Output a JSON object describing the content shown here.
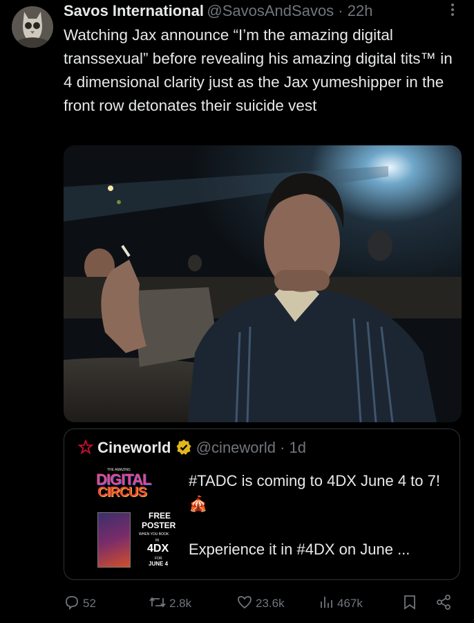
{
  "tweet": {
    "display_name": "Savos International",
    "handle": "@SavosAndSavos",
    "separator": " · ",
    "time": "22h",
    "text": "Watching Jax announce “I’m the amazing digital transsexual” before revealing his amazing digital tits™ in 4 dimensional clarity just as the Jax yumeshipper in the front row detonates their suicide vest"
  },
  "media": {
    "icon": "movie-theater-photo"
  },
  "quote": {
    "display_name": "Cineworld",
    "handle": "@cineworld",
    "separator": " · ",
    "time": "1d",
    "text_line1": "#TADC is coming to 4DX June 4 to 7! 🎪",
    "text_line2": "Experience it in #4DX on June ...",
    "thumb": {
      "tag": "THE AMAZING",
      "title1": "DIGITAL",
      "title2": "CIRCUS",
      "free": "FREE",
      "poster": "POSTER",
      "when": "WHEN YOU BOOK",
      "in": "IN",
      "brand": "4DX",
      "for": "FOR",
      "date": "JUNE 4"
    }
  },
  "actions": {
    "replies": "52",
    "reposts": "2.8k",
    "likes": "23.6k",
    "views": "467k"
  },
  "colors": {
    "background": "#000000",
    "text": "#e7e9ea",
    "muted": "#71767b",
    "border": "#2f3336",
    "verified": "#e2b719",
    "cineworld_red": "#c8102e"
  }
}
